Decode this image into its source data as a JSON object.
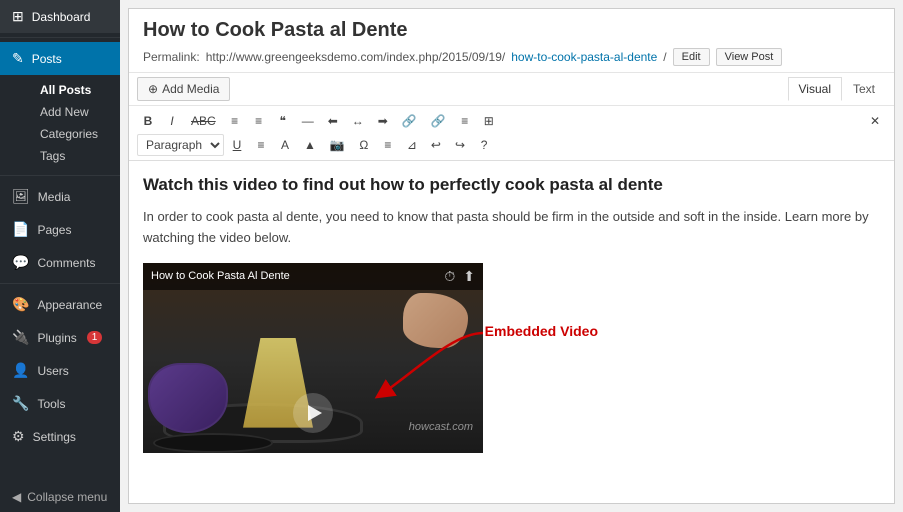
{
  "sidebar": {
    "brand": "Dashboard",
    "items": [
      {
        "id": "dashboard",
        "label": "Dashboard",
        "icon": "⊞",
        "active": false
      },
      {
        "id": "posts",
        "label": "Posts",
        "icon": "✎",
        "active": true
      },
      {
        "id": "media",
        "label": "Media",
        "icon": "🖼",
        "active": false
      },
      {
        "id": "pages",
        "label": "Pages",
        "icon": "📄",
        "active": false
      },
      {
        "id": "comments",
        "label": "Comments",
        "icon": "💬",
        "active": false
      },
      {
        "id": "appearance",
        "label": "Appearance",
        "icon": "🎨",
        "active": false
      },
      {
        "id": "plugins",
        "label": "Plugins",
        "icon": "🔌",
        "active": false,
        "badge": "1"
      },
      {
        "id": "users",
        "label": "Users",
        "icon": "👤",
        "active": false
      },
      {
        "id": "tools",
        "label": "Tools",
        "icon": "🔧",
        "active": false
      },
      {
        "id": "settings",
        "label": "Settings",
        "icon": "⚙",
        "active": false
      }
    ],
    "posts_sub": [
      "All Posts",
      "Add New",
      "Categories",
      "Tags"
    ],
    "collapse": "Collapse menu"
  },
  "editor": {
    "post_title": "How to Cook Pasta al Dente",
    "permalink_label": "Permalink:",
    "permalink_url": "http://www.greengeeksdemo.com/index.php/2015/09/19/how-to-cook-pasta-al-dente/",
    "permalink_slug": "how-to-cook-pasta-al-dente",
    "edit_btn": "Edit",
    "view_post_btn": "View Post",
    "add_media_btn": "Add Media",
    "visual_tab": "Visual",
    "text_tab": "Text",
    "toolbar": {
      "row1": [
        "B",
        "I",
        "ABC",
        "≡",
        "≡",
        "❝",
        "—",
        "≡",
        "≡",
        "≡",
        "🔗",
        "🔗",
        "≡",
        "⊞"
      ],
      "row2": [
        "Paragraph",
        "U",
        "≡",
        "A",
        "▲",
        "📷",
        "Ω",
        "≡",
        "⊿",
        "↩",
        "↪",
        "?"
      ]
    },
    "content_heading": "Watch this video to find out how to perfectly cook pasta al dente",
    "content_para": "In order to cook pasta al dente, you need to know that pasta should be firm in the outside and soft in the inside. Learn more by watching the video below.",
    "video_title": "How to Cook Pasta Al Dente",
    "video_watermark": "howcast.com",
    "embedded_label": "Embedded Video"
  }
}
